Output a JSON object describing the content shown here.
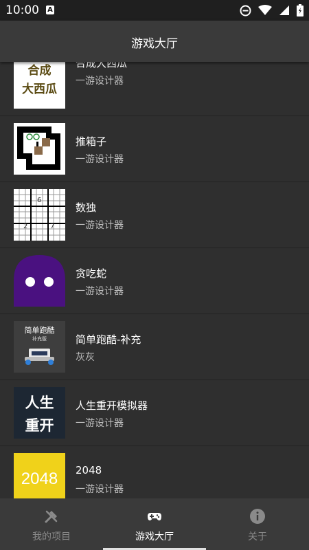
{
  "status": {
    "time": "10:00",
    "badge": "A"
  },
  "header": {
    "title": "游戏大厅"
  },
  "games": [
    {
      "name": "合成大西瓜",
      "author": "一游设计器",
      "thumb_text": [
        "合成",
        "大西瓜"
      ]
    },
    {
      "name": "推箱子",
      "author": "一游设计器"
    },
    {
      "name": "数独",
      "author": "一游设计器",
      "thumb_digits": [
        "6",
        "2",
        "7"
      ]
    },
    {
      "name": "贪吃蛇",
      "author": "一游设计器"
    },
    {
      "name": "简单跑酷-补充",
      "author": "灰灰",
      "thumb_text": [
        "简单跑酷",
        "补充版"
      ]
    },
    {
      "name": "人生重开模拟器",
      "author": "一游设计器",
      "thumb_text": [
        "人生",
        "重开"
      ]
    },
    {
      "name": "2048",
      "author": "一游设计器",
      "thumb_text": [
        "2048"
      ]
    }
  ],
  "nav": [
    {
      "label": "我的项目",
      "icon": "build-tools-icon",
      "active": false
    },
    {
      "label": "游戏大厅",
      "icon": "gamepad-icon",
      "active": true
    },
    {
      "label": "关于",
      "icon": "info-icon",
      "active": false
    }
  ],
  "colors": {
    "background": "#2f2f2f",
    "appbar": "#3a3a3a",
    "statusbar": "#1f1f1f",
    "watermelon_text": "#5a4a12",
    "ghost": "#4a1180",
    "yellow_2048": "#f0d21a",
    "life_sim_bg": "#1d2733"
  }
}
